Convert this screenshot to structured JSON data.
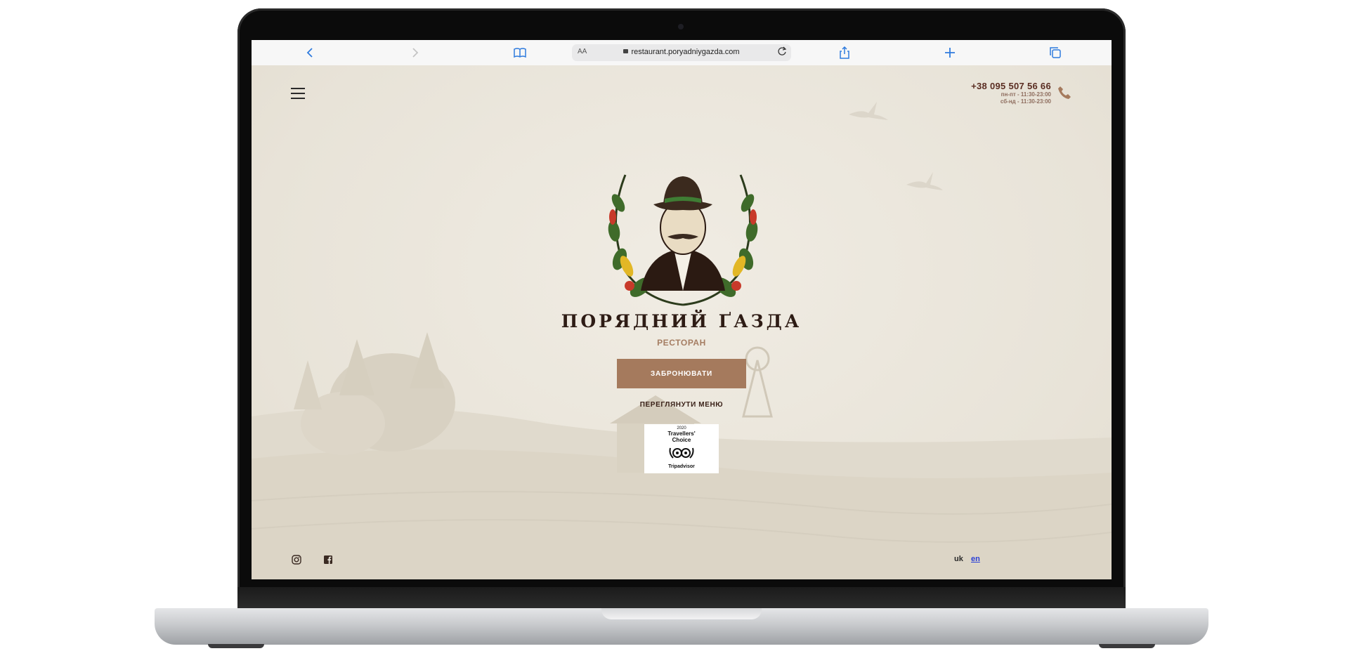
{
  "browser": {
    "reader_mode_label": "AA",
    "url": "restaurant.poryadniygazda.com"
  },
  "header": {
    "phone": "+38 095 507 56 66",
    "hours_weekdays": "пн-пт - 11:30-23:00",
    "hours_weekend": "сб-нд - 11:30-23:00"
  },
  "hero": {
    "brand_name": "ПОРЯДНИЙ ҐАЗДА",
    "subtitle": "РЕСТОРАН",
    "book_button": "ЗАБРОНЮВАТИ",
    "menu_link": "ПЕРЕГЛЯНУТИ МЕНЮ"
  },
  "badge": {
    "year": "2020",
    "line1": "Travellers'",
    "line2": "Choice",
    "brand": "Tripadvisor"
  },
  "footer": {
    "languages": [
      "uk",
      "en"
    ]
  },
  "colors": {
    "accent": "#a57a5d",
    "brand_text": "#2e1c15",
    "link_blue": "#2f7bde"
  }
}
